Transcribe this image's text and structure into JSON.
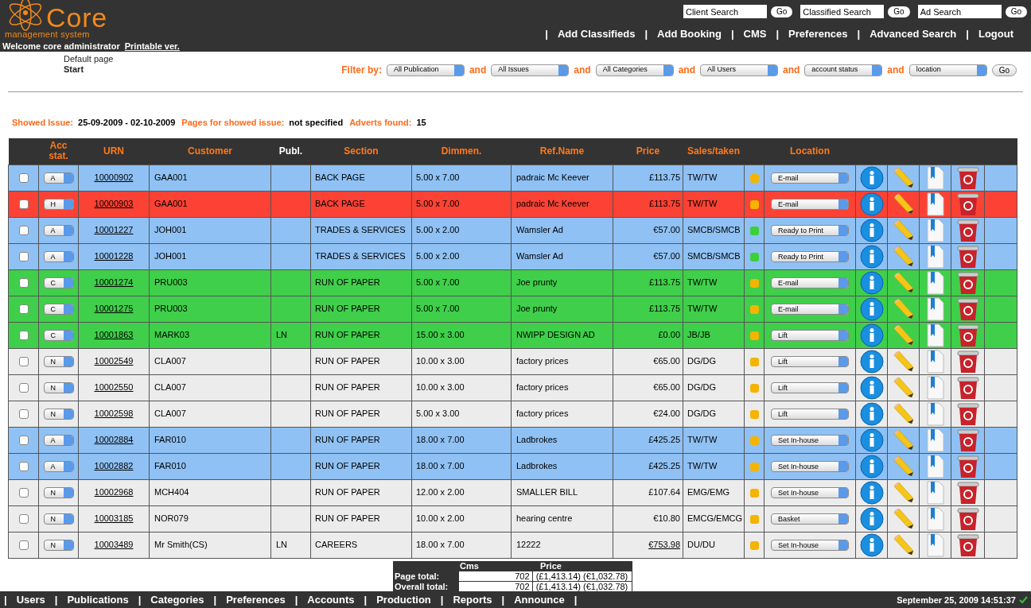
{
  "logo": {
    "name": "Core",
    "tagline": "management system"
  },
  "welcome": "Welcome core administrator",
  "printable_link": "Printable ver.",
  "searches": [
    {
      "placeholder": "Client Search",
      "button": "Go"
    },
    {
      "placeholder": "Classified Search",
      "button": "Go"
    },
    {
      "placeholder": "Ad Search",
      "button": "Go"
    }
  ],
  "nav": [
    {
      "separator": "|",
      "label": "Add Classifieds"
    },
    {
      "separator": "|",
      "label": "Add Booking"
    },
    {
      "separator": "|",
      "label": "CMS"
    },
    {
      "separator": "|",
      "label": "Preferences"
    },
    {
      "separator": "|",
      "label": "Advanced Search"
    },
    {
      "separator": "|",
      "label": "Logout"
    }
  ],
  "breadcrumb": {
    "page": "Default page",
    "current": "Start"
  },
  "filter": {
    "label": "Filter by:",
    "selects": [
      {
        "value": "All Publication"
      },
      {
        "joiner": "and",
        "value": "All Issues"
      },
      {
        "joiner": "and",
        "value": "All Categories"
      },
      {
        "joiner": "and",
        "value": "All Users"
      },
      {
        "joiner": "and",
        "value": "account status"
      },
      {
        "joiner": "and",
        "value": "location"
      }
    ],
    "button": "Go"
  },
  "summary": [
    {
      "label": "Showed Issue:",
      "value": "25-09-2009 - 02-10-2009"
    },
    {
      "label": "Pages for showed issue:",
      "value": "not specified"
    },
    {
      "label": "Adverts found:",
      "value": "15"
    }
  ],
  "table": {
    "columns": [
      {
        "label": "Acc stat.",
        "accent": true,
        "blank_before": true
      },
      {
        "label": "URN",
        "accent": true,
        "blank_before": false
      },
      {
        "label": "Customer",
        "accent": true,
        "blank_before": false
      },
      {
        "label": "Publ.",
        "accent": false,
        "blank_before": false
      },
      {
        "label": "Section",
        "accent": true,
        "blank_before": false
      },
      {
        "label": "Dimmen.",
        "accent": true,
        "blank_before": false
      },
      {
        "label": "Ref.Name",
        "accent": true,
        "blank_before": false
      },
      {
        "label": "Price",
        "accent": true,
        "blank_before": false
      },
      {
        "label": "Sales/taken",
        "accent": true,
        "blank_before": false
      },
      {
        "label": "Location",
        "accent": true,
        "blank_before": true
      }
    ],
    "rows": [
      {
        "color": "#8fc1f4",
        "checked": false,
        "acc": "A",
        "urn": "10000902",
        "customer": "GAA001",
        "publ": "",
        "section": "BACK PAGE",
        "dim": "5.00 x 7.00",
        "ref": "padraic Mc Keever",
        "price": "£113.75",
        "price_linked": false,
        "sales": "TW/TW",
        "status": {
          "color": "#f5b400"
        },
        "location": "E-mail"
      },
      {
        "color": "#fb4234",
        "checked": false,
        "acc": "H",
        "urn": "10000903",
        "customer": "GAA001",
        "publ": "",
        "section": "BACK PAGE",
        "dim": "5.00 x 7.00",
        "ref": "padraic Mc Keever",
        "price": "£113.75",
        "price_linked": false,
        "sales": "TW/TW",
        "status": {
          "color": "#f5b400"
        },
        "location": "E-mail"
      },
      {
        "color": "#8fc1f4",
        "checked": false,
        "acc": "A",
        "urn": "10001227",
        "customer": "JOH001",
        "publ": "",
        "section": "TRADES & SERVICES",
        "dim": "5.00 x 2.00",
        "ref": "Wamsler Ad",
        "price": "€57.00",
        "price_linked": false,
        "sales": "SMCB/SMCB",
        "status": {
          "color": "#3ad03a"
        },
        "location": "Ready to Print"
      },
      {
        "color": "#8fc1f4",
        "checked": false,
        "acc": "A",
        "urn": "10001228",
        "customer": "JOH001",
        "publ": "",
        "section": "TRADES & SERVICES",
        "dim": "5.00 x 2.00",
        "ref": "Wamsler Ad",
        "price": "€57.00",
        "price_linked": false,
        "sales": "SMCB/SMCB",
        "status": {
          "color": "#3ad03a"
        },
        "location": "Ready to Print"
      },
      {
        "color": "#3fcf4a",
        "checked": false,
        "acc": "C",
        "urn": "10001274",
        "customer": "PRU003",
        "publ": "",
        "section": "RUN OF PAPER",
        "dim": "5.00 x 7.00",
        "ref": "Joe prunty",
        "price": "£113.75",
        "price_linked": false,
        "sales": "TW/TW",
        "status": {
          "color": "#f5b400"
        },
        "location": "E-mail"
      },
      {
        "color": "#3fcf4a",
        "checked": false,
        "acc": "C",
        "urn": "10001275",
        "customer": "PRU003",
        "publ": "",
        "section": "RUN OF PAPER",
        "dim": "5.00 x 7.00",
        "ref": "Joe prunty",
        "price": "£113.75",
        "price_linked": false,
        "sales": "TW/TW",
        "status": {
          "color": "#f5b400"
        },
        "location": "E-mail"
      },
      {
        "color": "#3fcf4a",
        "checked": false,
        "acc": "C",
        "urn": "10001863",
        "customer": "MARK03",
        "publ": "LN",
        "section": "RUN OF PAPER",
        "dim": "15.00 x 3.00",
        "ref": "NWIPP DESIGN AD",
        "price": "£0.00",
        "price_linked": false,
        "sales": "JB/JB",
        "status": {
          "color": "#f5b400"
        },
        "location": "Lift"
      },
      {
        "color": "#ececec",
        "checked": false,
        "acc": "N",
        "urn": "10002549",
        "customer": "CLA007",
        "publ": "",
        "section": "RUN OF PAPER",
        "dim": "10.00 x 3.00",
        "ref": "factory prices",
        "price": "€65.00",
        "price_linked": false,
        "sales": "DG/DG",
        "status": {
          "color": "#f5b400"
        },
        "location": "Lift"
      },
      {
        "color": "#ececec",
        "checked": false,
        "acc": "N",
        "urn": "10002550",
        "customer": "CLA007",
        "publ": "",
        "section": "RUN OF PAPER",
        "dim": "10.00 x 3.00",
        "ref": "factory prices",
        "price": "€65.00",
        "price_linked": false,
        "sales": "DG/DG",
        "status": {
          "color": "#f5b400"
        },
        "location": "Lift"
      },
      {
        "color": "#ececec",
        "checked": false,
        "acc": "N",
        "urn": "10002598",
        "customer": "CLA007",
        "publ": "",
        "section": "RUN OF PAPER",
        "dim": "5.00 x 3.00",
        "ref": "factory prices",
        "price": "€24.00",
        "price_linked": false,
        "sales": "DG/DG",
        "status": {
          "color": "#f5b400"
        },
        "location": "Lift"
      },
      {
        "color": "#8fc1f4",
        "checked": false,
        "acc": "A",
        "urn": "10002884",
        "customer": "FAR010",
        "publ": "",
        "section": "RUN OF PAPER",
        "dim": "18.00 x 7.00",
        "ref": "Ladbrokes",
        "price": "£425.25",
        "price_linked": false,
        "sales": "TW/TW",
        "status": {
          "color": "#f5b400"
        },
        "location": "Set In-house"
      },
      {
        "color": "#8fc1f4",
        "checked": false,
        "acc": "A",
        "urn": "10002882",
        "customer": "FAR010",
        "publ": "",
        "section": "RUN OF PAPER",
        "dim": "18.00 x 7.00",
        "ref": "Ladbrokes",
        "price": "£425.25",
        "price_linked": false,
        "sales": "TW/TW",
        "status": {
          "color": "#f5b400"
        },
        "location": "Set In-house"
      },
      {
        "color": "#ececec",
        "checked": false,
        "acc": "N",
        "urn": "10002968",
        "customer": "MCH404",
        "publ": "",
        "section": "RUN OF PAPER",
        "dim": "12.00 x 2.00",
        "ref": "SMALLER BILL",
        "price": "£107.64",
        "price_linked": false,
        "sales": "EMG/EMG",
        "status": {
          "color": "#f5b400"
        },
        "location": "Set In-house"
      },
      {
        "color": "#ececec",
        "checked": false,
        "acc": "N",
        "urn": "10003185",
        "customer": "NOR079",
        "publ": "",
        "section": "RUN OF PAPER",
        "dim": "10.00 x 2.00",
        "ref": "hearing centre",
        "price": "€10.80",
        "price_linked": false,
        "sales": "EMCG/EMCG",
        "status": {
          "color": "#f5b400"
        },
        "location": "Basket"
      },
      {
        "color": "#ececec",
        "checked": false,
        "acc": "N",
        "urn": "10003489",
        "customer": "Mr Smith(CS)",
        "publ": "LN",
        "section": "CAREERS",
        "dim": "18.00 x 7.00",
        "ref": "12222",
        "price": "€753.98",
        "price_linked": true,
        "sales": "DU/DU",
        "status": {
          "color": "#f5b400"
        },
        "location": "Set In-house"
      }
    ]
  },
  "totals": {
    "columns": [
      "Cms",
      "Price"
    ],
    "rows": [
      {
        "label": "Page total:",
        "cms": "702",
        "price": "(£1,413.14) (€1,032.78)"
      },
      {
        "label": "Overall total:",
        "cms": "702",
        "price": "(£1,413.14) (€1,032.78)"
      }
    ]
  },
  "footer_nav": [
    {
      "separator": "|",
      "label": "Users"
    },
    {
      "separator": "|",
      "label": "Publications"
    },
    {
      "separator": "|",
      "label": "Categories"
    },
    {
      "separator": "|",
      "label": "Preferences"
    },
    {
      "separator": "|",
      "label": "Accounts"
    },
    {
      "separator": "|",
      "label": "Production"
    },
    {
      "separator": "|",
      "label": "Reports"
    },
    {
      "separator": "|",
      "label": "Announce"
    }
  ],
  "footer_end_separator": "|",
  "datetime": "September 25, 2009 14:51:37"
}
